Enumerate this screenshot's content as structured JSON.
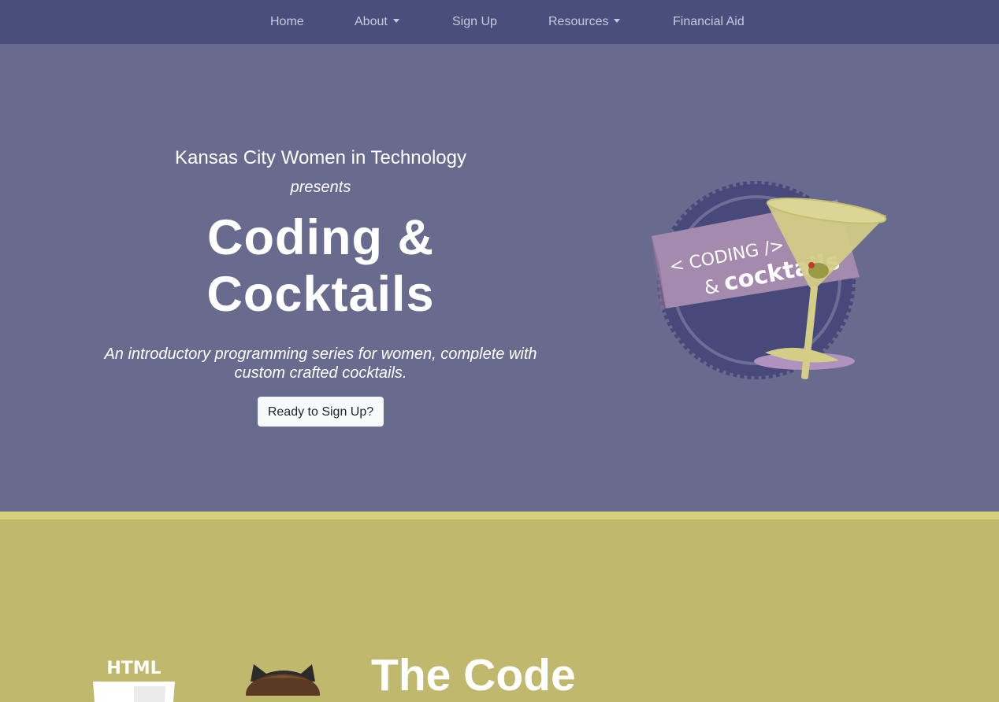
{
  "nav": {
    "items": [
      {
        "label": "Home",
        "dropdown": false
      },
      {
        "label": "About",
        "dropdown": true
      },
      {
        "label": "Sign Up",
        "dropdown": false
      },
      {
        "label": "Resources",
        "dropdown": true
      },
      {
        "label": "Financial Aid",
        "dropdown": false
      }
    ]
  },
  "hero": {
    "org": "Kansas City Women in Technology",
    "presents": "presents",
    "title_line1": "Coding &",
    "title_line2": "Cocktails",
    "tagline_line1": "An introductory programming series for women, complete with",
    "tagline_line2": "custom crafted cocktails.",
    "cta_label": "Ready to Sign Up?",
    "logo": {
      "banner_line1": "< CODING />",
      "banner_amp": "&",
      "banner_line2": "cocktails"
    }
  },
  "code_section": {
    "title": "The Code",
    "html_badge": "HTML"
  },
  "colors": {
    "navbar": "#4a4e7b",
    "hero": "#686b8d",
    "stripe": "#d6cf7c",
    "code_section": "#bfb86d"
  }
}
